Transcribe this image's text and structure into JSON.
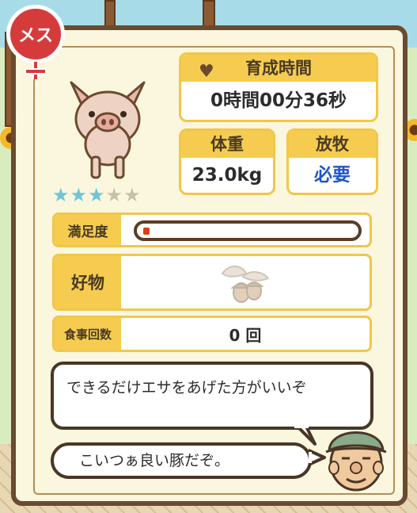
{
  "gender": {
    "label": "メス",
    "color": "#d63b3b"
  },
  "pig": {
    "icon": "pig-icon"
  },
  "rating": {
    "filled": 3,
    "total": 5,
    "stars": [
      "★",
      "★",
      "★",
      "★",
      "★"
    ]
  },
  "growth_time": {
    "label": "育成時間",
    "value": "0時間00分36秒",
    "icon": "heart-icon"
  },
  "weight": {
    "label": "体重",
    "value": "23.0kg"
  },
  "grazing": {
    "label": "放牧",
    "value": "必要",
    "value_color": "#1f57c7"
  },
  "satisfaction": {
    "label": "満足度",
    "level_fraction": 0.03
  },
  "favorite": {
    "label": "好物",
    "icon": "acorn-icon"
  },
  "meals": {
    "label": "食事回数",
    "value": "0 回"
  },
  "dialogue": {
    "hint": "できるだけエサをあげた方がいいぞ",
    "comment": "こいつぁ良い豚だぞ。",
    "speaker_icon": "farmer-icon"
  },
  "colors": {
    "frame": "#6b4a2f",
    "header": "#f5cc4f",
    "star_on": "#6cc6d9",
    "star_off": "#c9c1a6"
  }
}
